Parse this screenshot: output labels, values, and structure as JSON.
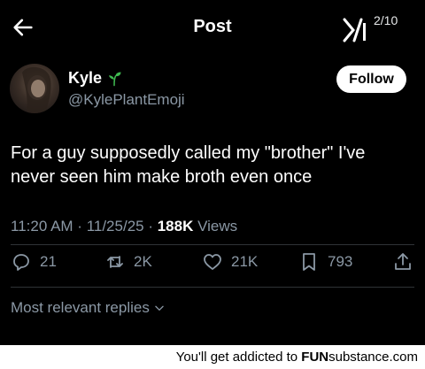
{
  "header": {
    "title": "Post",
    "page_indicator": "2/10"
  },
  "author": {
    "name": "Kyle",
    "handle": "@KylePlantEmoji",
    "follow_label": "Follow"
  },
  "tweet": {
    "text": "For a guy supposedly called my \"brother\" I've never seen him make broth even once"
  },
  "meta": {
    "time": "11:20 AM",
    "date": "11/25/25",
    "views_count": "188K",
    "views_label": "Views",
    "sep": " · "
  },
  "actions": {
    "replies": "21",
    "reposts": "2K",
    "likes": "21K",
    "bookmarks": "793"
  },
  "replies": {
    "sort_label": "Most relevant replies"
  },
  "footer": {
    "prefix": "You'll get addicted to ",
    "brand_bold": "FUN",
    "brand_rest": "substance.com"
  },
  "colors": {
    "background": "#000000",
    "muted": "#8b98a5",
    "text": "#e7e9ea",
    "accent_green": "#3fb950"
  },
  "icons": [
    "back-arrow-icon",
    "x-logo-icon",
    "sprout-icon",
    "reply-icon",
    "repost-icon",
    "like-icon",
    "bookmark-icon",
    "share-icon",
    "chevron-down-icon"
  ]
}
